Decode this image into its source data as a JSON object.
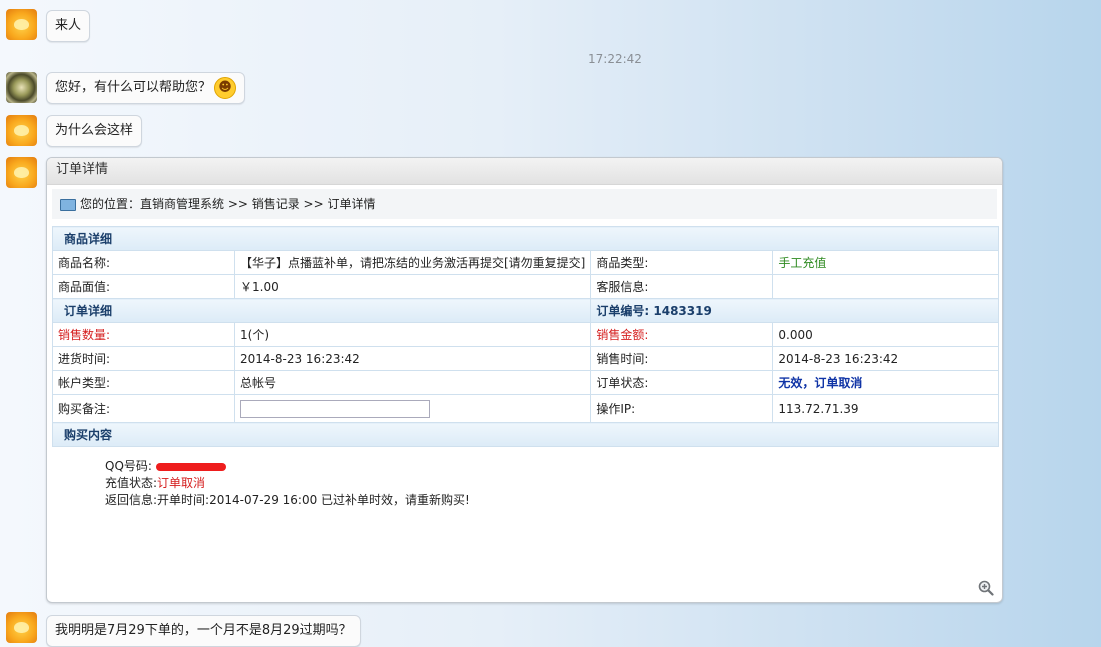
{
  "messages": {
    "m1": "来人",
    "time": "17:22:42",
    "m2": "您好，有什么可以帮助您？",
    "m2_emoji": "emoji-wink-icon",
    "m3": "为什么会这样",
    "m5": "我明明是7月29下单的，一个月不是8月29过期吗？"
  },
  "panel": {
    "title": "订单详情",
    "breadcrumb": "您的位置：直销商管理系统 >> 销售记录 >> 订单详情",
    "section_goods": "商品详细",
    "goods_name_label": "商品名称:",
    "goods_name_value": "【华子】点播蓝补单，请把冻结的业务激活再提交[请勿重复提交]",
    "goods_type_label": "商品类型:",
    "goods_type_value": "手工充值",
    "face_value_label": "商品面值:",
    "face_value_value": "￥1.00",
    "service_label": "客服信息:",
    "service_value": "",
    "section_order": "订单详细",
    "order_no_label": "订单编号:",
    "order_no_value": "1483319",
    "qty_label": "销售数量:",
    "qty_value": "1(个)",
    "amount_label": "销售金额:",
    "amount_value": "0.000",
    "in_time_label": "进货时间:",
    "in_time_value": "2014-8-23 16:23:42",
    "sale_time_label": "销售时间:",
    "sale_time_value": "2014-8-23 16:23:42",
    "acct_type_label": "帐户类型:",
    "acct_type_value": "总帐号",
    "status_label": "订单状态:",
    "status_value": "无效，订单取消",
    "remark_label": "购买备注:",
    "ip_label": "操作IP:",
    "ip_value": "113.72.71.39",
    "section_content": "购买内容",
    "qq_label": "QQ号码:",
    "recharge_label": "充值状态:",
    "recharge_value": "订单取消",
    "return_label": "返回信息:",
    "return_value": "开单时间:2014-07-29 16:00 已过补单时效，请重新购买!"
  }
}
